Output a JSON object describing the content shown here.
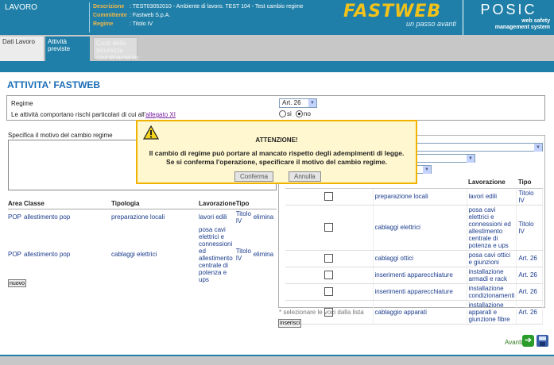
{
  "header": {
    "title": "LAVORO",
    "meta": [
      {
        "label": "Descrizione",
        "value": ": TEST03052010 - Ambiente di lavoro. TEST 104 - Test cambio regime"
      },
      {
        "label": "Committente",
        "value": ": Fastweb S.p.A."
      },
      {
        "label": "Regime",
        "value": ": Titolo IV"
      }
    ],
    "fastweb_logo": "FASTWEB",
    "fastweb_tagline": "un passo avanti",
    "posic_logo": "POSIC",
    "posic_tagline_1": "web safety",
    "posic_tagline_2": "management system"
  },
  "tabs": [
    {
      "label": "Dati Lavoro"
    },
    {
      "label": "Attività previste"
    },
    {
      "label": "Costi della sicurezza coordinamento"
    }
  ],
  "page_title": "ATTIVITA' FASTWEB",
  "regime": {
    "label": "Regime",
    "selected": "Art. 26",
    "risk_label": "Le attività comportano rischi particolari di cui all'",
    "risk_link": "allegato XI",
    "opt_si": "si",
    "opt_no": "no"
  },
  "motivo_label": "Specifica il motivo del cambio regime",
  "left_table": {
    "headers": [
      "Area",
      "Classe",
      "Tipologia",
      "Lavorazione",
      "Tipo"
    ],
    "rows": [
      {
        "area": "POP",
        "classe": "allestimento pop",
        "tipologia": "preparazione locali",
        "lavorazione": "lavori edili",
        "tipo": "Titolo IV",
        "action": "elimina"
      },
      {
        "area": "POP",
        "classe": "allestimento pop",
        "tipologia": "cablaggi elettrici",
        "lavorazione": "posa cavi elettrici e connessioni ed allestimento centrale di potenza e ups",
        "tipo": "Titolo IV",
        "action": "elimina"
      }
    ],
    "new_button": "nuovo"
  },
  "right_table": {
    "headers": [
      "",
      "",
      "Lavorazione",
      "Tipo"
    ],
    "rows": [
      {
        "tipologia": "preparazione locali",
        "lavorazione": "lavori edili",
        "tipo": "Titolo IV"
      },
      {
        "tipologia": "cablaggi elettrici",
        "lavorazione": "posa cavi elettrici e connessioni ed allestimento centrale di potenza e ups",
        "tipo": "Titolo IV"
      },
      {
        "tipologia": "cablaggi ottici",
        "lavorazione": "posa cavi ottici e giunzioni",
        "tipo": "Art. 26"
      },
      {
        "tipologia": "inserimenti apparecchiature",
        "lavorazione": "installazione armadi e rack",
        "tipo": "Art. 26"
      },
      {
        "tipologia": "inserimenti apparecchiature",
        "lavorazione": "installazione condizionamenti",
        "tipo": "Art. 26"
      },
      {
        "tipologia": "cablaggio apparati",
        "lavorazione": "installazione apparati e giunzione fibre",
        "tipo": "Art. 26"
      }
    ],
    "hint": "* selezionare le voci dalla lista",
    "insert_button": "inserisci"
  },
  "footer": {
    "next_label": "Avanti"
  },
  "modal": {
    "title": "ATTENZIONE!",
    "line1": "Il cambio di regime può portare al mancato rispetto degli adempimenti di legge.",
    "line2": "Se si conferma l'operazione, specificare il motivo del cambio regime.",
    "confirm": "Conferma",
    "cancel": "Annulla"
  },
  "colors": {
    "brand": "#1f7fa8",
    "accent": "#f0b84a",
    "modal_border": "#f0b400",
    "link": "#1a3c8c"
  }
}
